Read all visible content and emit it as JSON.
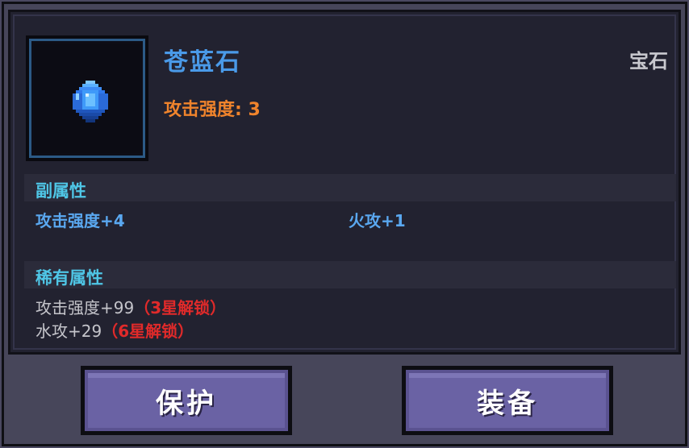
{
  "item": {
    "name": "苍蓝石",
    "type": "宝石",
    "main_stat": "攻击强度: 3",
    "icon": "blue-gem-icon"
  },
  "sub_attributes": {
    "title": "副属性",
    "items": [
      "攻击强度+4",
      "火攻+1"
    ]
  },
  "rare_attributes": {
    "title": "稀有属性",
    "items": [
      {
        "stat": "攻击强度+99",
        "lock": "（3星解锁）"
      },
      {
        "stat": "水攻+29",
        "lock": "（6星解锁）"
      }
    ]
  },
  "buttons": {
    "protect": "保护",
    "equip": "装备"
  },
  "colors": {
    "name": "#4a9ae8",
    "main_stat": "#f0842c",
    "section_title": "#4fc6e6",
    "sub_stat": "#5aa8f0",
    "lock": "#e02a2a",
    "button": "#6a62a4"
  }
}
